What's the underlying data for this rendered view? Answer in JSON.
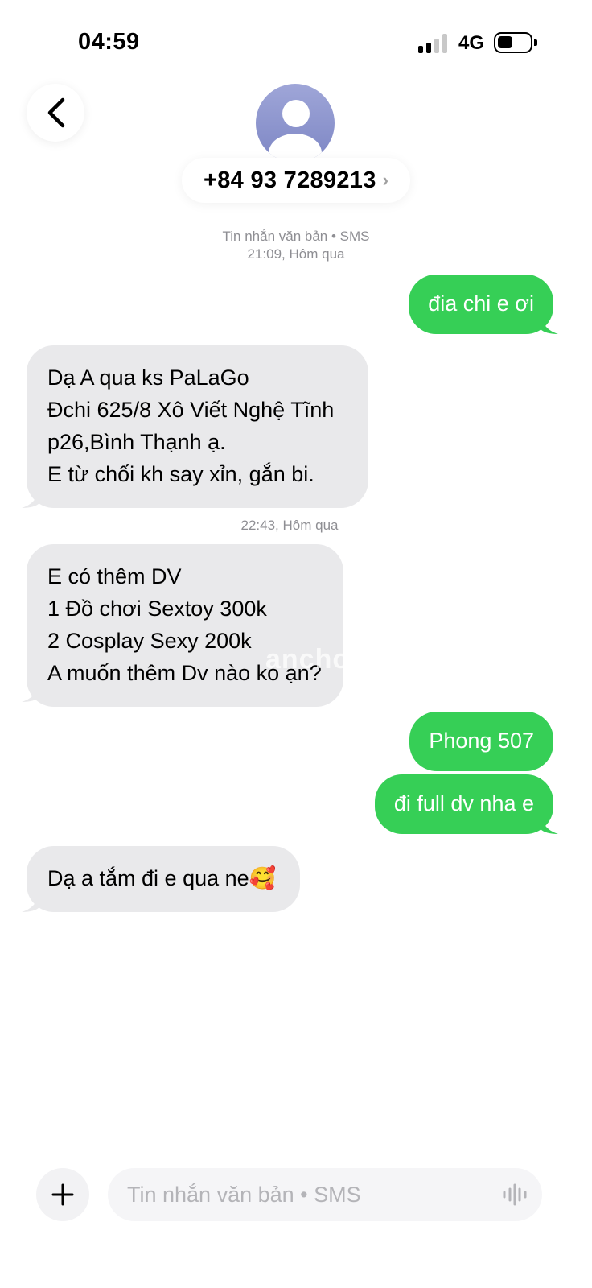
{
  "status_bar": {
    "time": "04:59",
    "network": "4G",
    "signal_bars_active": 2,
    "signal_bars_total": 4,
    "battery_level_fraction": 0.35
  },
  "header": {
    "back_icon": "chevron-left-icon",
    "avatar_icon": "person-icon",
    "contact_number": "+84 93 7289213",
    "contact_chevron": "›"
  },
  "conversation": {
    "meta_1_type": "Tin nhắn văn bản • SMS",
    "meta_1_time": "21:09, Hôm qua",
    "meta_2_time": "22:43, Hôm qua",
    "messages": [
      {
        "direction": "outgoing",
        "lines": [
          "đia chi e ơi"
        ]
      },
      {
        "direction": "incoming",
        "lines": [
          "Dạ A qua ks PaLaGo",
          "Đchi 625/8 Xô Viết Nghệ Tĩnh",
          "p26,Bình Thạnh ạ.",
          "E từ chối kh say xỉn, gắn bi."
        ]
      },
      {
        "direction": "incoming",
        "lines": [
          "E có thêm DV",
          "1 Đồ chơi Sextoy 300k",
          "2 Cosplay Sexy 200k",
          "A muốn thêm Dv nào ko ạn?"
        ]
      },
      {
        "direction": "outgoing",
        "lines": [
          "Phong 507"
        ]
      },
      {
        "direction": "outgoing",
        "lines": [
          "đi full dv nha e"
        ]
      },
      {
        "direction": "incoming",
        "lines": [
          "Dạ a tắm đi e qua ne🥰"
        ]
      }
    ],
    "watermark": "ancho"
  },
  "composer": {
    "add_icon": "plus-icon",
    "placeholder": "Tin nhắn văn bản • SMS",
    "value": "",
    "voice_icon": "waveform-icon"
  },
  "colors": {
    "outgoing_bubble": "#36cf56",
    "incoming_bubble": "#e9e9eb",
    "meta_text": "#8e8e93"
  }
}
